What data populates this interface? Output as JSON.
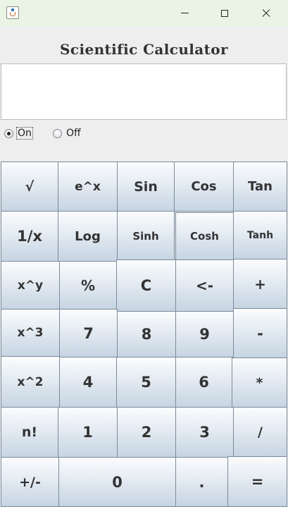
{
  "window": {
    "title": ""
  },
  "app": {
    "heading": "Scientific Calculator"
  },
  "display": {
    "value": ""
  },
  "power": {
    "on_label": "On",
    "off_label": "Off",
    "selected": "On"
  },
  "keypad": {
    "sqrt": "√",
    "exp": "e^x",
    "sin": "Sin",
    "cos": "Cos",
    "tan": "Tan",
    "reciprocal": "1/x",
    "log": "Log",
    "sinh": "Sinh",
    "cosh": "Cosh",
    "tanh": "Tanh",
    "power": "x^y",
    "percent": "%",
    "clear": "C",
    "backspace": "<-",
    "add": "+",
    "cube": "x^3",
    "d7": "7",
    "d8": "8",
    "d9": "9",
    "subtract": "-",
    "square": "x^2",
    "d4": "4",
    "d5": "5",
    "d6": "6",
    "multiply": "*",
    "factorial": "n!",
    "d1": "1",
    "d2": "2",
    "d3": "3",
    "divide": "/",
    "negate": "+/-",
    "d0": "0",
    "decimal": ".",
    "equals": "="
  }
}
